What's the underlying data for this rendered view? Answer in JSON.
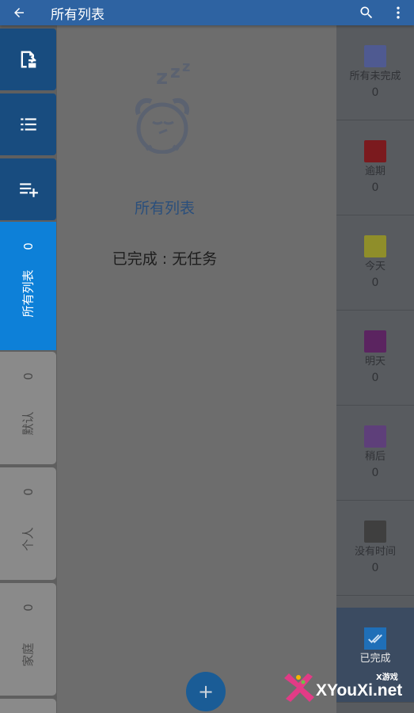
{
  "appbar": {
    "title": "所有列表",
    "icons": [
      "back-arrow-icon",
      "search-icon",
      "more-vert-icon"
    ]
  },
  "main": {
    "empty_title": "所有列表",
    "status_label": "已完成",
    "status_colon": " : ",
    "status_value": "无任务",
    "fab_label": "+"
  },
  "rail": {
    "buttons": [
      "import-icon",
      "list-icon",
      "playlist-add-icon"
    ],
    "tabs": [
      {
        "label": "所有列表",
        "count": "0",
        "active": true
      },
      {
        "label": "默认",
        "count": "0"
      },
      {
        "label": "个人",
        "count": "0"
      },
      {
        "label": "家庭",
        "count": "0"
      }
    ]
  },
  "filters": [
    {
      "label": "所有未完成",
      "count": "0",
      "color": "#4f5a91"
    },
    {
      "label": "逾期",
      "count": "0",
      "color": "#7b1a1e"
    },
    {
      "label": "今天",
      "count": "0",
      "color": "#8f8e2a"
    },
    {
      "label": "明天",
      "count": "0",
      "color": "#5b2460"
    },
    {
      "label": "稍后",
      "count": "0",
      "color": "#5e3f7a"
    },
    {
      "label": "没有时间",
      "count": "0",
      "color": "#3f3f3f"
    },
    {
      "label": "已完成",
      "count": ""
    }
  ],
  "watermark": {
    "text": "XYouXi.net",
    "sub": "X游戏"
  },
  "colors": {
    "appbar": "#2e63a2",
    "active_tab": "#0d80d8",
    "rail_button": "#184c7f"
  }
}
